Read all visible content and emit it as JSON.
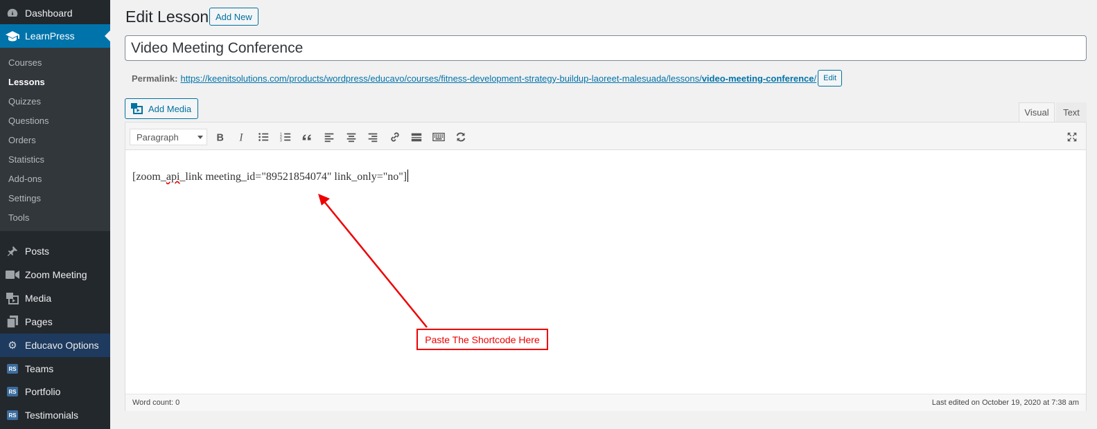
{
  "sidebar": {
    "dashboard": "Dashboard",
    "learnpress": "LearnPress",
    "submenu": [
      "Courses",
      "Lessons",
      "Quizzes",
      "Questions",
      "Orders",
      "Statistics",
      "Add-ons",
      "Settings",
      "Tools"
    ],
    "posts": "Posts",
    "zoom": "Zoom Meeting",
    "media": "Media",
    "pages": "Pages",
    "educavo": "Educavo Options",
    "teams": "Teams",
    "portfolio": "Portfolio",
    "testimonials": "Testimonials",
    "rs_badge": "RS"
  },
  "header": {
    "title": "Edit Lesson",
    "add_new": "Add New"
  },
  "post": {
    "title": "Video Meeting Conference"
  },
  "permalink": {
    "label": "Permalink:",
    "base": "https://keenitsolutions.com/products/wordpress/educavo/courses/fitness-development-strategy-buildup-laoreet-malesuada/lessons/",
    "slug": "video-meeting-conference",
    "trailing": "/",
    "edit": "Edit"
  },
  "editor": {
    "add_media": "Add Media",
    "tab_visual": "Visual",
    "tab_text": "Text",
    "format": "Paragraph",
    "content_pre": "[zoom_",
    "content_spell": "api",
    "content_post": "_link meeting_id=\"89521854074\" link_only=\"no\"]",
    "word_count": "Word count: 0",
    "last_edited": "Last edited on October 19, 2020 at 7:38 am"
  },
  "annotation": {
    "text": "Paste The Shortcode Here"
  },
  "colors": {
    "accent": "#0073aa",
    "sidebar": "#23282d",
    "annotation": "#ee0000"
  }
}
